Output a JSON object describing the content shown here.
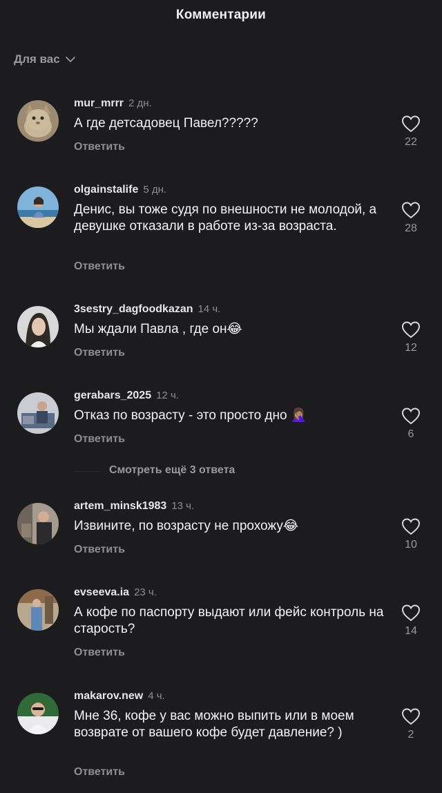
{
  "header": {
    "title": "Комментарии"
  },
  "filter": {
    "label": "Для вас"
  },
  "reply_label": "Ответить",
  "comments": [
    {
      "username": "mur_mrrr",
      "time": "2 дн.",
      "text": "А где детсадовец Павел?????",
      "likes": "22"
    },
    {
      "username": "olgainstalife",
      "time": "5 дн.",
      "text": "Денис, вы тоже судя по внешности не молодой, а девушке отказали в работе из-за возраста.",
      "likes": "28"
    },
    {
      "username": "3sestry_dagfoodkazan",
      "time": "14 ч.",
      "text": "Мы ждали  Павла , где он😂",
      "likes": "12"
    },
    {
      "username": "gerabars_2025",
      "time": "12 ч.",
      "text": "Отказ по возрасту - это просто дно 🤦🏽‍♀️",
      "likes": "6"
    },
    {
      "username": "artem_minsk1983",
      "time": "13 ч.",
      "text": "Извините, по возрасту не прохожу😂",
      "likes": "10"
    },
    {
      "username": "evseeva.ia",
      "time": "23 ч.",
      "text": "А кофе по паспорту выдают или фейс контроль на старость?",
      "likes": "14"
    },
    {
      "username": "makarov.new",
      "time": "4 ч.",
      "text": "Мне 36, кофе у вас можно выпить или в моем возврате от вашего кофе будет давление? )",
      "likes": "2"
    }
  ],
  "more_replies": {
    "label": "Смотреть ещё 3 ответа"
  },
  "colors": {
    "background": "#1c1c1e",
    "text": "#f4f4f6",
    "muted": "#8e8e93"
  }
}
